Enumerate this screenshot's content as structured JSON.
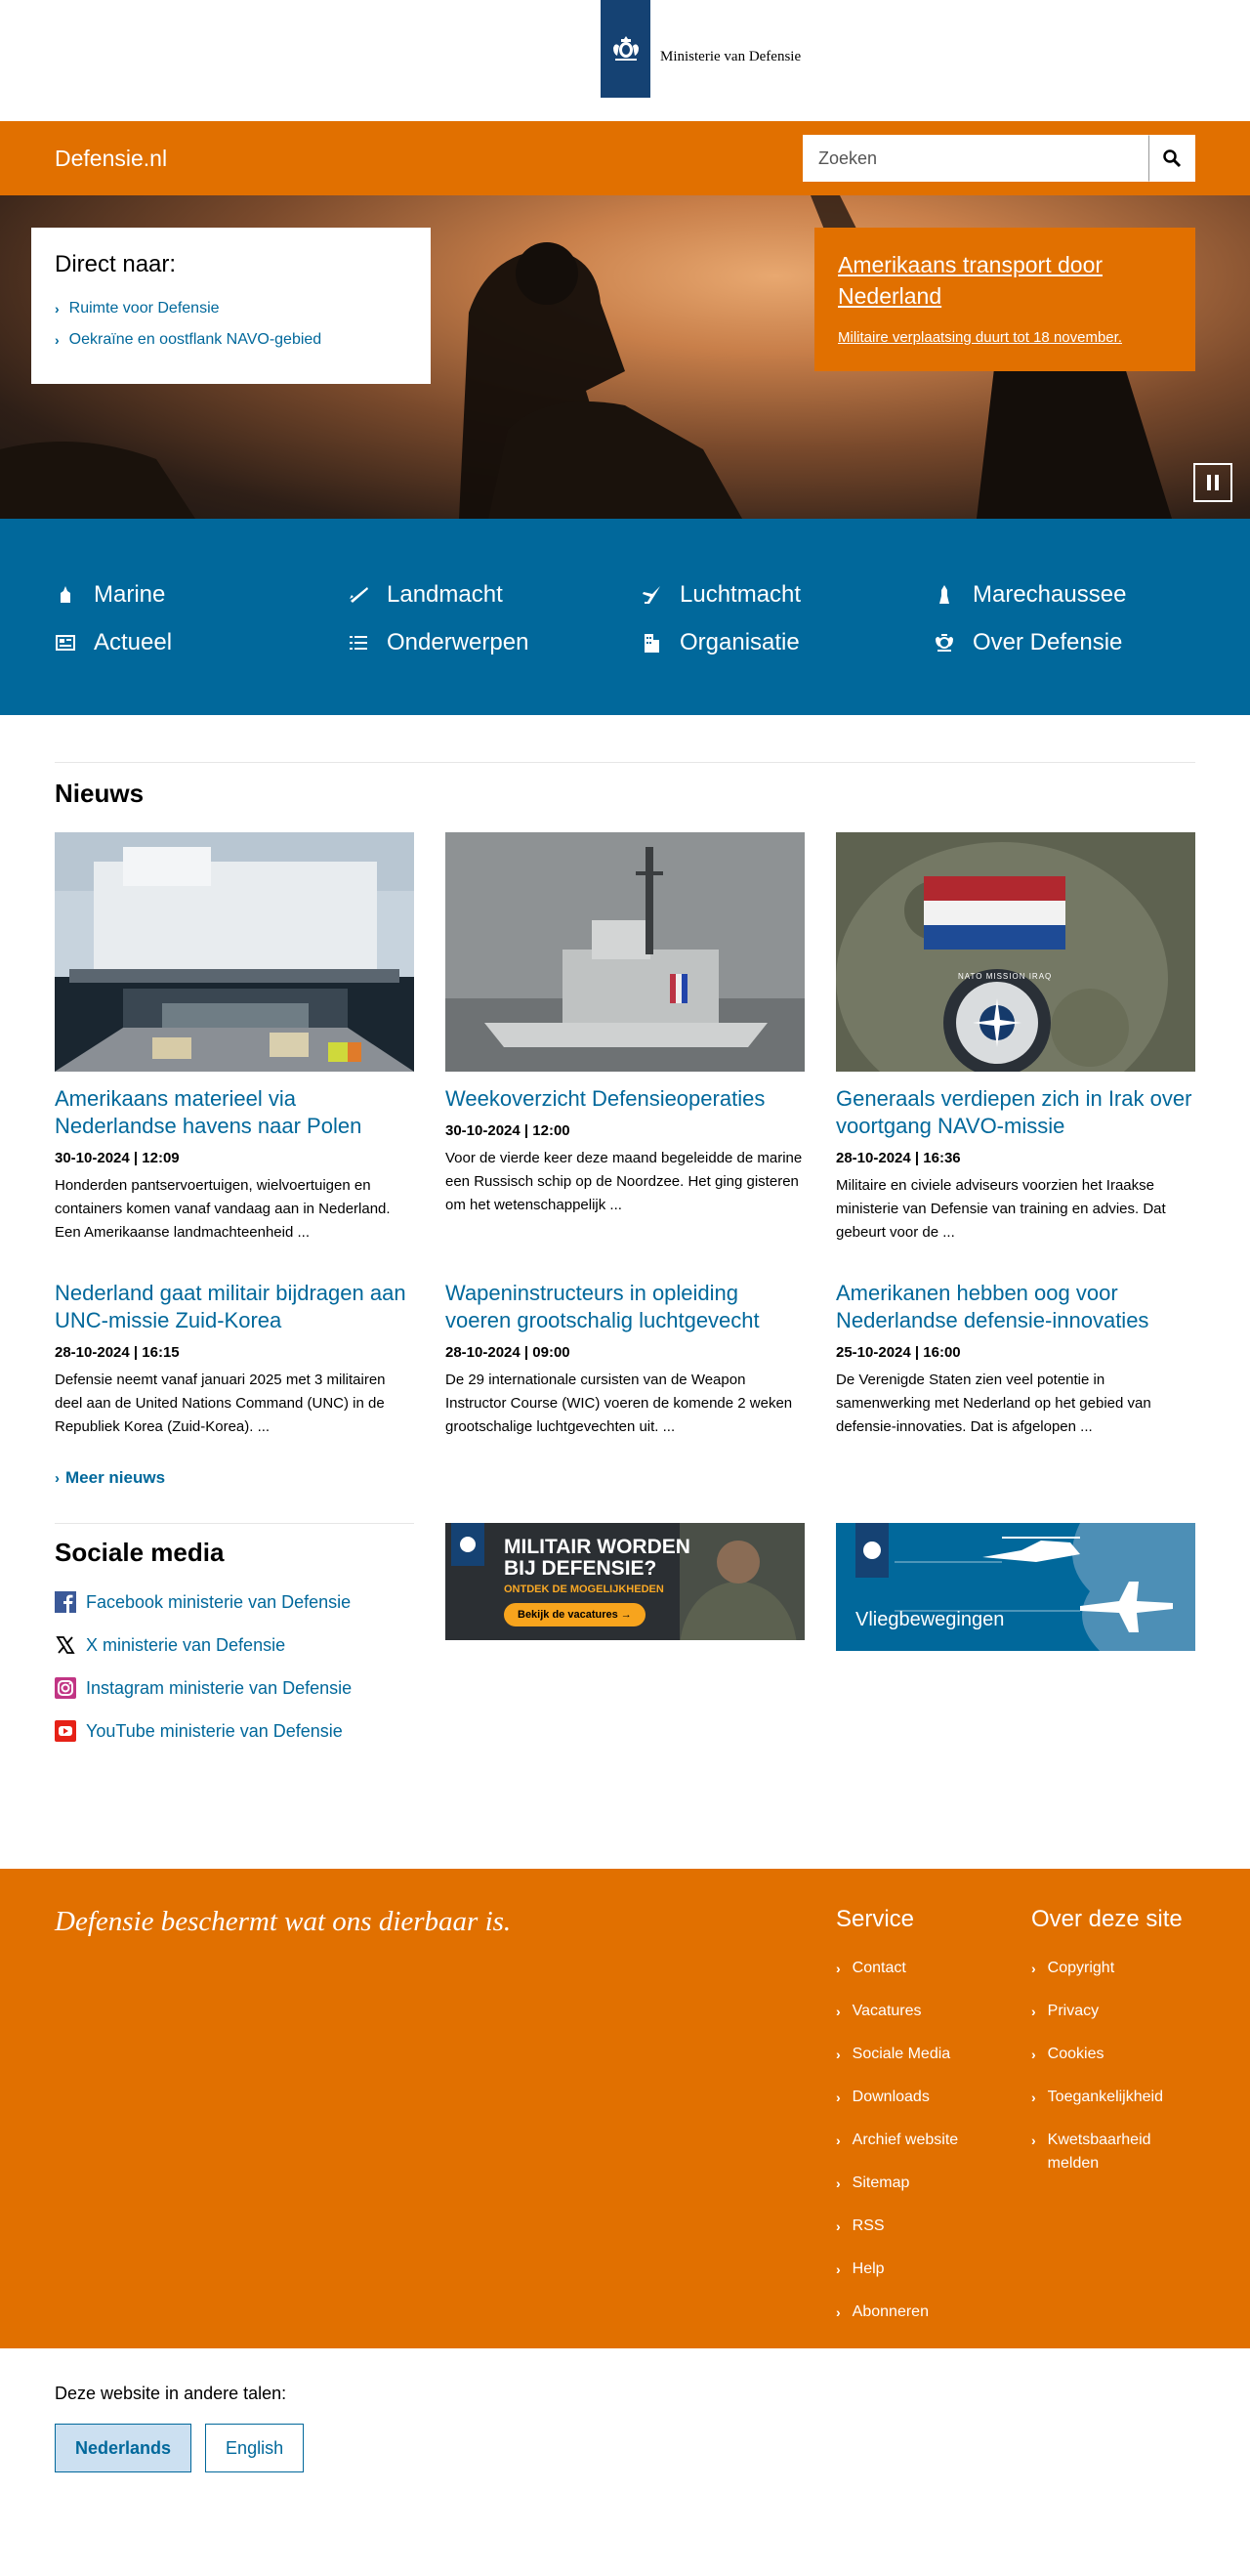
{
  "header": {
    "logo_text": "Ministerie van Defensie",
    "site_name": "Defensie.nl",
    "search_placeholder": "Zoeken"
  },
  "hero": {
    "direct_title": "Direct naar:",
    "direct_links": [
      "Ruimte voor Defensie",
      "Oekraïne en oostflank NAVO-gebied"
    ],
    "feature_title": "Amerikaans transport door Nederland",
    "feature_sub": "Militaire verplaatsing duurt tot 18 november."
  },
  "nav": {
    "items": [
      {
        "label": "Marine",
        "icon": "ship-icon"
      },
      {
        "label": "Landmacht",
        "icon": "rifle-icon"
      },
      {
        "label": "Luchtmacht",
        "icon": "jet-icon"
      },
      {
        "label": "Marechaussee",
        "icon": "marechaussee-icon"
      },
      {
        "label": "Actueel",
        "icon": "newspaper-icon"
      },
      {
        "label": "Onderwerpen",
        "icon": "list-icon"
      },
      {
        "label": "Organisatie",
        "icon": "building-icon"
      },
      {
        "label": "Over Defensie",
        "icon": "emblem-icon"
      }
    ]
  },
  "news": {
    "title": "Nieuws",
    "items": [
      {
        "title": "Amerikaans materieel via Nederlandse havens naar Polen",
        "date": "30-10-2024 | 12:09",
        "desc": "Honderden pantservoertuigen, wielvoertuigen en containers komen vanaf vandaag aan in Nederland. Een Amerikaanse landmachteenheid ..."
      },
      {
        "title": "Weekoverzicht Defensieoperaties",
        "date": "30-10-2024 | 12:00",
        "desc": "Voor de vierde keer deze maand begeleidde de marine een Russisch schip op de Noordzee. Het ging gisteren om het wetenschappelijk ..."
      },
      {
        "title": "Generaals verdiepen zich in Irak over voortgang NAVO-missie",
        "date": "28-10-2024 | 16:36",
        "desc": "Militaire en civiele adviseurs voorzien het Iraakse ministerie van Defensie van training en advies. Dat gebeurt voor de ..."
      },
      {
        "title": "Nederland gaat militair bijdragen aan UNC-missie Zuid-Korea",
        "date": "28-10-2024 | 16:15",
        "desc": "Defensie neemt vanaf januari 2025 met 3 militairen deel aan de United Nations Command (UNC) in de Republiek Korea (Zuid-Korea). ..."
      },
      {
        "title": "Wapeninstructeurs in opleiding voeren grootschalig luchtgevecht",
        "date": "28-10-2024 | 09:00",
        "desc": "De 29 internationale cursisten van de Weapon Instructor Course (WIC) voeren de komende 2 weken grootschalige luchtgevechten uit. ..."
      },
      {
        "title": "Amerikanen hebben oog voor Nederlandse defensie-innovaties",
        "date": "25-10-2024 | 16:00",
        "desc": "De Verenigde Staten zien veel potentie in samenwerking met Nederland op het gebied van defensie-innovaties. Dat is afgelopen ..."
      }
    ],
    "more": "Meer nieuws",
    "img3_patch_text": "NATO MISSION IRAQ"
  },
  "social": {
    "title": "Sociale media",
    "items": [
      {
        "label": "Facebook ministerie van Defensie",
        "icon": "facebook-icon",
        "color": "#3b5998"
      },
      {
        "label": "X ministerie van Defensie",
        "icon": "x-icon",
        "color": "#000000"
      },
      {
        "label": "Instagram ministerie van Defensie",
        "icon": "instagram-icon",
        "color": "#c13584"
      },
      {
        "label": "YouTube ministerie van Defensie",
        "icon": "youtube-icon",
        "color": "#e62117"
      }
    ]
  },
  "banners": {
    "vacatures_line1": "MILITAIR WORDEN",
    "vacatures_line2": "BIJ DEFENSIE?",
    "vacatures_line3": "ONTDEK DE MOGELIJKHEDEN",
    "vacatures_button": "Bekijk de vacatures →",
    "vlieg_label": "Vliegbewegingen"
  },
  "footer": {
    "slogan": "Defensie beschermt wat ons dierbaar is.",
    "service_title": "Service",
    "service_links": [
      "Contact",
      "Vacatures",
      "Sociale Media",
      "Downloads",
      "Archief website",
      "Sitemap",
      "RSS",
      "Help",
      "Abonneren"
    ],
    "about_title": "Over deze site",
    "about_links": [
      "Copyright",
      "Privacy",
      "Cookies",
      "Toegankelijkheid",
      "Kwetsbaarheid melden"
    ]
  },
  "languages": {
    "label": "Deze website in andere talen:",
    "options": [
      "Nederlands",
      "English"
    ]
  },
  "colors": {
    "orange": "#e17000",
    "blue": "#01689b",
    "logo_blue": "#154273"
  }
}
